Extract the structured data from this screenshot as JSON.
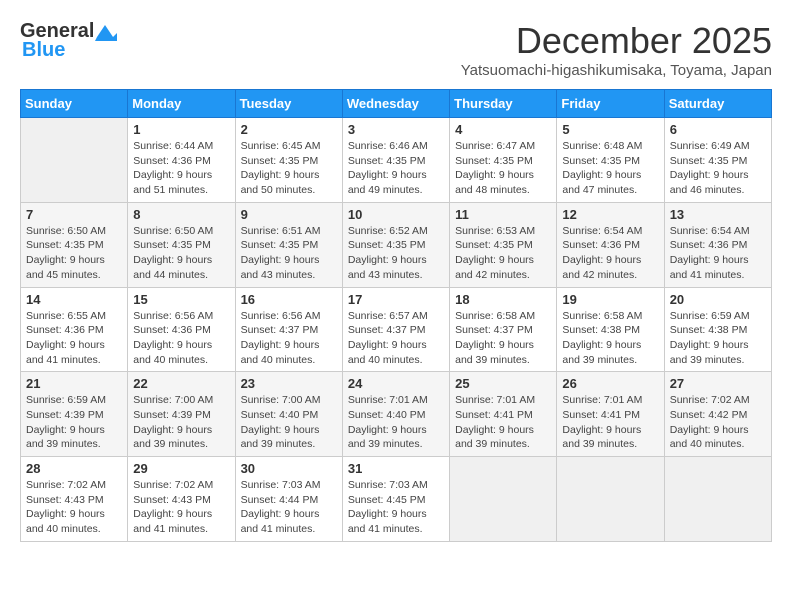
{
  "header": {
    "logo_general": "General",
    "logo_blue": "Blue",
    "month_title": "December 2025",
    "location": "Yatsuomachi-higashikumisaka, Toyama, Japan"
  },
  "weekdays": [
    "Sunday",
    "Monday",
    "Tuesday",
    "Wednesday",
    "Thursday",
    "Friday",
    "Saturday"
  ],
  "weeks": [
    [
      {
        "day": "",
        "sunrise": "",
        "sunset": "",
        "daylight": ""
      },
      {
        "day": "1",
        "sunrise": "Sunrise: 6:44 AM",
        "sunset": "Sunset: 4:36 PM",
        "daylight": "Daylight: 9 hours and 51 minutes."
      },
      {
        "day": "2",
        "sunrise": "Sunrise: 6:45 AM",
        "sunset": "Sunset: 4:35 PM",
        "daylight": "Daylight: 9 hours and 50 minutes."
      },
      {
        "day": "3",
        "sunrise": "Sunrise: 6:46 AM",
        "sunset": "Sunset: 4:35 PM",
        "daylight": "Daylight: 9 hours and 49 minutes."
      },
      {
        "day": "4",
        "sunrise": "Sunrise: 6:47 AM",
        "sunset": "Sunset: 4:35 PM",
        "daylight": "Daylight: 9 hours and 48 minutes."
      },
      {
        "day": "5",
        "sunrise": "Sunrise: 6:48 AM",
        "sunset": "Sunset: 4:35 PM",
        "daylight": "Daylight: 9 hours and 47 minutes."
      },
      {
        "day": "6",
        "sunrise": "Sunrise: 6:49 AM",
        "sunset": "Sunset: 4:35 PM",
        "daylight": "Daylight: 9 hours and 46 minutes."
      }
    ],
    [
      {
        "day": "7",
        "sunrise": "Sunrise: 6:50 AM",
        "sunset": "Sunset: 4:35 PM",
        "daylight": "Daylight: 9 hours and 45 minutes."
      },
      {
        "day": "8",
        "sunrise": "Sunrise: 6:50 AM",
        "sunset": "Sunset: 4:35 PM",
        "daylight": "Daylight: 9 hours and 44 minutes."
      },
      {
        "day": "9",
        "sunrise": "Sunrise: 6:51 AM",
        "sunset": "Sunset: 4:35 PM",
        "daylight": "Daylight: 9 hours and 43 minutes."
      },
      {
        "day": "10",
        "sunrise": "Sunrise: 6:52 AM",
        "sunset": "Sunset: 4:35 PM",
        "daylight": "Daylight: 9 hours and 43 minutes."
      },
      {
        "day": "11",
        "sunrise": "Sunrise: 6:53 AM",
        "sunset": "Sunset: 4:35 PM",
        "daylight": "Daylight: 9 hours and 42 minutes."
      },
      {
        "day": "12",
        "sunrise": "Sunrise: 6:54 AM",
        "sunset": "Sunset: 4:36 PM",
        "daylight": "Daylight: 9 hours and 42 minutes."
      },
      {
        "day": "13",
        "sunrise": "Sunrise: 6:54 AM",
        "sunset": "Sunset: 4:36 PM",
        "daylight": "Daylight: 9 hours and 41 minutes."
      }
    ],
    [
      {
        "day": "14",
        "sunrise": "Sunrise: 6:55 AM",
        "sunset": "Sunset: 4:36 PM",
        "daylight": "Daylight: 9 hours and 41 minutes."
      },
      {
        "day": "15",
        "sunrise": "Sunrise: 6:56 AM",
        "sunset": "Sunset: 4:36 PM",
        "daylight": "Daylight: 9 hours and 40 minutes."
      },
      {
        "day": "16",
        "sunrise": "Sunrise: 6:56 AM",
        "sunset": "Sunset: 4:37 PM",
        "daylight": "Daylight: 9 hours and 40 minutes."
      },
      {
        "day": "17",
        "sunrise": "Sunrise: 6:57 AM",
        "sunset": "Sunset: 4:37 PM",
        "daylight": "Daylight: 9 hours and 40 minutes."
      },
      {
        "day": "18",
        "sunrise": "Sunrise: 6:58 AM",
        "sunset": "Sunset: 4:37 PM",
        "daylight": "Daylight: 9 hours and 39 minutes."
      },
      {
        "day": "19",
        "sunrise": "Sunrise: 6:58 AM",
        "sunset": "Sunset: 4:38 PM",
        "daylight": "Daylight: 9 hours and 39 minutes."
      },
      {
        "day": "20",
        "sunrise": "Sunrise: 6:59 AM",
        "sunset": "Sunset: 4:38 PM",
        "daylight": "Daylight: 9 hours and 39 minutes."
      }
    ],
    [
      {
        "day": "21",
        "sunrise": "Sunrise: 6:59 AM",
        "sunset": "Sunset: 4:39 PM",
        "daylight": "Daylight: 9 hours and 39 minutes."
      },
      {
        "day": "22",
        "sunrise": "Sunrise: 7:00 AM",
        "sunset": "Sunset: 4:39 PM",
        "daylight": "Daylight: 9 hours and 39 minutes."
      },
      {
        "day": "23",
        "sunrise": "Sunrise: 7:00 AM",
        "sunset": "Sunset: 4:40 PM",
        "daylight": "Daylight: 9 hours and 39 minutes."
      },
      {
        "day": "24",
        "sunrise": "Sunrise: 7:01 AM",
        "sunset": "Sunset: 4:40 PM",
        "daylight": "Daylight: 9 hours and 39 minutes."
      },
      {
        "day": "25",
        "sunrise": "Sunrise: 7:01 AM",
        "sunset": "Sunset: 4:41 PM",
        "daylight": "Daylight: 9 hours and 39 minutes."
      },
      {
        "day": "26",
        "sunrise": "Sunrise: 7:01 AM",
        "sunset": "Sunset: 4:41 PM",
        "daylight": "Daylight: 9 hours and 39 minutes."
      },
      {
        "day": "27",
        "sunrise": "Sunrise: 7:02 AM",
        "sunset": "Sunset: 4:42 PM",
        "daylight": "Daylight: 9 hours and 40 minutes."
      }
    ],
    [
      {
        "day": "28",
        "sunrise": "Sunrise: 7:02 AM",
        "sunset": "Sunset: 4:43 PM",
        "daylight": "Daylight: 9 hours and 40 minutes."
      },
      {
        "day": "29",
        "sunrise": "Sunrise: 7:02 AM",
        "sunset": "Sunset: 4:43 PM",
        "daylight": "Daylight: 9 hours and 41 minutes."
      },
      {
        "day": "30",
        "sunrise": "Sunrise: 7:03 AM",
        "sunset": "Sunset: 4:44 PM",
        "daylight": "Daylight: 9 hours and 41 minutes."
      },
      {
        "day": "31",
        "sunrise": "Sunrise: 7:03 AM",
        "sunset": "Sunset: 4:45 PM",
        "daylight": "Daylight: 9 hours and 41 minutes."
      },
      {
        "day": "",
        "sunrise": "",
        "sunset": "",
        "daylight": ""
      },
      {
        "day": "",
        "sunrise": "",
        "sunset": "",
        "daylight": ""
      },
      {
        "day": "",
        "sunrise": "",
        "sunset": "",
        "daylight": ""
      }
    ]
  ]
}
